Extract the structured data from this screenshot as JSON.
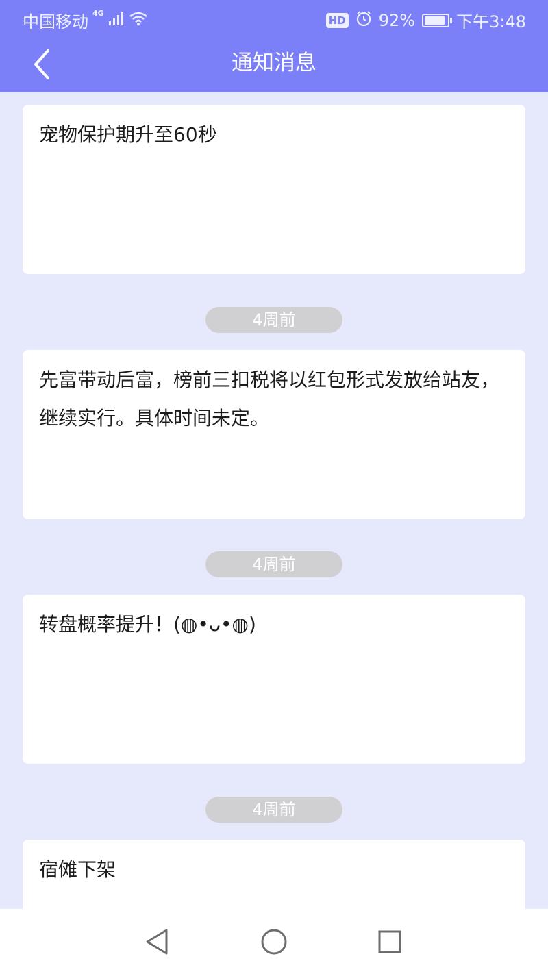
{
  "status_bar": {
    "carrier": "中国移动",
    "network": "4G",
    "hd": "HD",
    "battery_percent": "92%",
    "time": "下午3:48"
  },
  "header": {
    "title": "通知消息"
  },
  "notifications": [
    {
      "text": "宠物保护期升至60秒"
    },
    {
      "time": "4周前",
      "text": "先富带动后富，榜前三扣税将以红包形式发放给站友，继续实行。具体时间未定。"
    },
    {
      "time": "4周前",
      "text": "转盘概率提升！(◍•ᴗ•◍)"
    },
    {
      "time": "4周前",
      "text": "宿傩下架"
    }
  ],
  "icons": {
    "back": "chevron-left-icon",
    "signal": "signal-icon",
    "wifi": "wifi-icon",
    "alarm": "alarm-icon",
    "battery": "battery-icon",
    "nav_back": "triangle-back-icon",
    "nav_home": "circle-home-icon",
    "nav_recents": "square-recents-icon"
  },
  "colors": {
    "header": "#7b80f9",
    "background": "#e6e9fb",
    "card": "#ffffff",
    "time_pill": "#d0d0d3"
  }
}
